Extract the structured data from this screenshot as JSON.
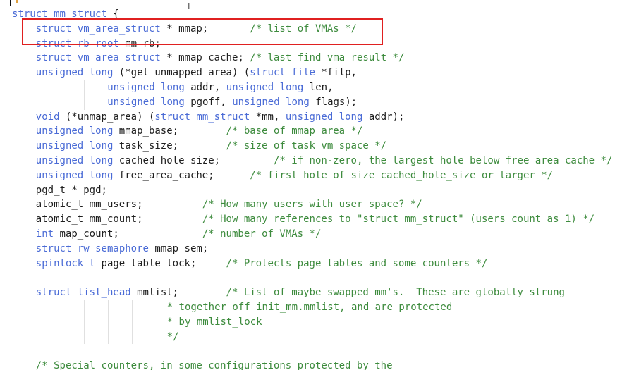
{
  "editor": {
    "cursor_glyph": "I",
    "lines": [
      {
        "indent": 0,
        "text": [
          {
            "c": "st",
            "t": "struct "
          },
          {
            "c": "ty",
            "t": "mm_struct"
          },
          {
            "c": "id",
            "t": " {"
          }
        ]
      },
      {
        "indent": 4,
        "text": [
          {
            "c": "kw",
            "t": "struct "
          },
          {
            "c": "ty",
            "t": "vm_area_struct"
          },
          {
            "c": "id",
            "t": " * mmap;       "
          },
          {
            "c": "cm",
            "t": "/* list of VMAs */"
          }
        ]
      },
      {
        "indent": 4,
        "text": [
          {
            "c": "kw",
            "t": "struct "
          },
          {
            "c": "ty",
            "t": "rb_root"
          },
          {
            "c": "id",
            "t": " mm_rb;"
          }
        ]
      },
      {
        "indent": 4,
        "text": [
          {
            "c": "kw",
            "t": "struct "
          },
          {
            "c": "ty",
            "t": "vm_area_struct"
          },
          {
            "c": "id",
            "t": " * mmap_cache; "
          },
          {
            "c": "cm",
            "t": "/* last find_vma result */"
          }
        ]
      },
      {
        "indent": 4,
        "text": [
          {
            "c": "kw",
            "t": "unsigned long"
          },
          {
            "c": "id",
            "t": " (*get_unmapped_area) ("
          },
          {
            "c": "kw",
            "t": "struct "
          },
          {
            "c": "ty",
            "t": "file"
          },
          {
            "c": "id",
            "t": " *filp,"
          }
        ]
      },
      {
        "indent": 16,
        "text": [
          {
            "c": "kw",
            "t": "unsigned long"
          },
          {
            "c": "id",
            "t": " addr, "
          },
          {
            "c": "kw",
            "t": "unsigned long"
          },
          {
            "c": "id",
            "t": " len,"
          }
        ]
      },
      {
        "indent": 16,
        "text": [
          {
            "c": "kw",
            "t": "unsigned long"
          },
          {
            "c": "id",
            "t": " pgoff, "
          },
          {
            "c": "kw",
            "t": "unsigned long"
          },
          {
            "c": "id",
            "t": " flags);"
          }
        ]
      },
      {
        "indent": 4,
        "text": [
          {
            "c": "kw",
            "t": "void"
          },
          {
            "c": "id",
            "t": " (*unmap_area) ("
          },
          {
            "c": "kw",
            "t": "struct "
          },
          {
            "c": "ty",
            "t": "mm_struct"
          },
          {
            "c": "id",
            "t": " *mm, "
          },
          {
            "c": "kw",
            "t": "unsigned long"
          },
          {
            "c": "id",
            "t": " addr);"
          }
        ]
      },
      {
        "indent": 4,
        "text": [
          {
            "c": "kw",
            "t": "unsigned long"
          },
          {
            "c": "id",
            "t": " mmap_base;        "
          },
          {
            "c": "cm",
            "t": "/* base of mmap area */"
          }
        ]
      },
      {
        "indent": 4,
        "text": [
          {
            "c": "kw",
            "t": "unsigned long"
          },
          {
            "c": "id",
            "t": " task_size;        "
          },
          {
            "c": "cm",
            "t": "/* size of task vm space */"
          }
        ]
      },
      {
        "indent": 4,
        "text": [
          {
            "c": "kw",
            "t": "unsigned long"
          },
          {
            "c": "id",
            "t": " cached_hole_size;         "
          },
          {
            "c": "cm",
            "t": "/* if non-zero, the largest hole below free_area_cache */"
          }
        ]
      },
      {
        "indent": 4,
        "text": [
          {
            "c": "kw",
            "t": "unsigned long"
          },
          {
            "c": "id",
            "t": " free_area_cache;      "
          },
          {
            "c": "cm",
            "t": "/* first hole of size cached_hole_size or larger */"
          }
        ]
      },
      {
        "indent": 4,
        "text": [
          {
            "c": "id",
            "t": "pgd_t * pgd;"
          }
        ]
      },
      {
        "indent": 4,
        "text": [
          {
            "c": "id",
            "t": "atomic_t mm_users;          "
          },
          {
            "c": "cm",
            "t": "/* How many users with user space? */"
          }
        ]
      },
      {
        "indent": 4,
        "text": [
          {
            "c": "id",
            "t": "atomic_t mm_count;          "
          },
          {
            "c": "cm",
            "t": "/* How many references to \"struct mm_struct\" (users count as 1) */"
          }
        ]
      },
      {
        "indent": 4,
        "text": [
          {
            "c": "kw",
            "t": "int"
          },
          {
            "c": "id",
            "t": " map_count;              "
          },
          {
            "c": "cm",
            "t": "/* number of VMAs */"
          }
        ]
      },
      {
        "indent": 4,
        "text": [
          {
            "c": "kw",
            "t": "struct "
          },
          {
            "c": "ty",
            "t": "rw_semaphore"
          },
          {
            "c": "id",
            "t": " mmap_sem;"
          }
        ]
      },
      {
        "indent": 4,
        "text": [
          {
            "c": "ty",
            "t": "spinlock_t"
          },
          {
            "c": "id",
            "t": " page_table_lock;     "
          },
          {
            "c": "cm",
            "t": "/* Protects page tables and some counters */"
          }
        ]
      },
      {
        "indent": 4,
        "text": []
      },
      {
        "indent": 4,
        "text": [
          {
            "c": "kw",
            "t": "struct "
          },
          {
            "c": "ty",
            "t": "list_head"
          },
          {
            "c": "id",
            "t": " mmlist;        "
          },
          {
            "c": "cm",
            "t": "/* List of maybe swapped mm's.  These are globally strung"
          }
        ]
      },
      {
        "indent": 25,
        "text": [
          {
            "c": "cm",
            "t": " * together off init_mm.mmlist, and are protected"
          }
        ]
      },
      {
        "indent": 25,
        "text": [
          {
            "c": "cm",
            "t": " * by mmlist_lock"
          }
        ]
      },
      {
        "indent": 25,
        "text": [
          {
            "c": "cm",
            "t": " */"
          }
        ]
      },
      {
        "indent": 4,
        "text": []
      },
      {
        "indent": 4,
        "text": [
          {
            "c": "cm",
            "t": "/* Special counters, in some configurations protected by the"
          }
        ]
      }
    ]
  }
}
